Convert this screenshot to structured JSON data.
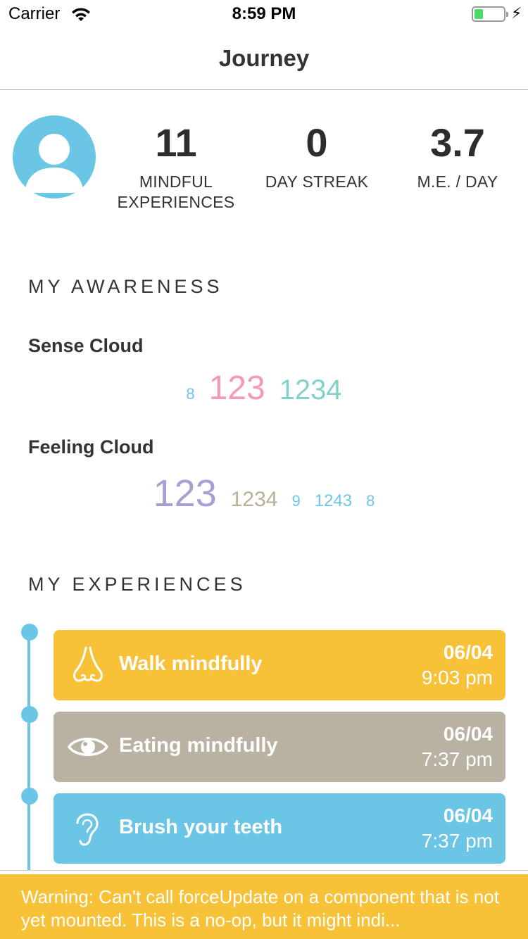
{
  "status_bar": {
    "carrier": "Carrier",
    "time": "8:59 PM",
    "battery_level": 0.3,
    "battery_color": "#4cd964"
  },
  "nav": {
    "title": "Journey"
  },
  "profile": {
    "avatar_icon": "user-silhouette-icon",
    "stats": [
      {
        "value": "11",
        "label_line1": "MINDFUL",
        "label_line2": "EXPERIENCES"
      },
      {
        "value": "0",
        "label_line1": "DAY STREAK",
        "label_line2": ""
      },
      {
        "value": "3.7",
        "label_line1": "M.E. / DAY",
        "label_line2": ""
      }
    ]
  },
  "awareness": {
    "heading": "MY AWARENESS",
    "sense_cloud": {
      "title": "Sense Cloud",
      "words": [
        {
          "text": "8",
          "color": "#6bc6e5"
        },
        {
          "text": "123",
          "color": "#f49ab8"
        },
        {
          "text": "1234",
          "color": "#7fd3c7"
        }
      ]
    },
    "feeling_cloud": {
      "title": "Feeling Cloud",
      "words": [
        {
          "text": "123",
          "color": "#a5a0d6"
        },
        {
          "text": "1234",
          "color": "#b9af98"
        },
        {
          "text": "9",
          "color": "#6bc6e5"
        },
        {
          "text": "1243",
          "color": "#6bc6e5"
        },
        {
          "text": "8",
          "color": "#6bc6e5"
        }
      ]
    }
  },
  "experiences": {
    "heading": "MY EXPERIENCES",
    "timeline_color": "#6bc6e5",
    "items": [
      {
        "title": "Walk mindfully",
        "date": "06/04",
        "time": "9:03 pm",
        "icon": "nose-icon",
        "color": "#f7c138"
      },
      {
        "title": "Eating mindfully",
        "date": "06/04",
        "time": "7:37 pm",
        "icon": "eye-icon",
        "color": "#b9b1a1"
      },
      {
        "title": "Brush your teeth",
        "date": "06/04",
        "time": "7:37 pm",
        "icon": "ear-icon",
        "color": "#6bc6e5"
      }
    ]
  },
  "warning": {
    "text": "Warning: Can't call forceUpdate on a component that is not yet mounted. This is a no-op, but it might indi...",
    "color": "#f7c138"
  }
}
